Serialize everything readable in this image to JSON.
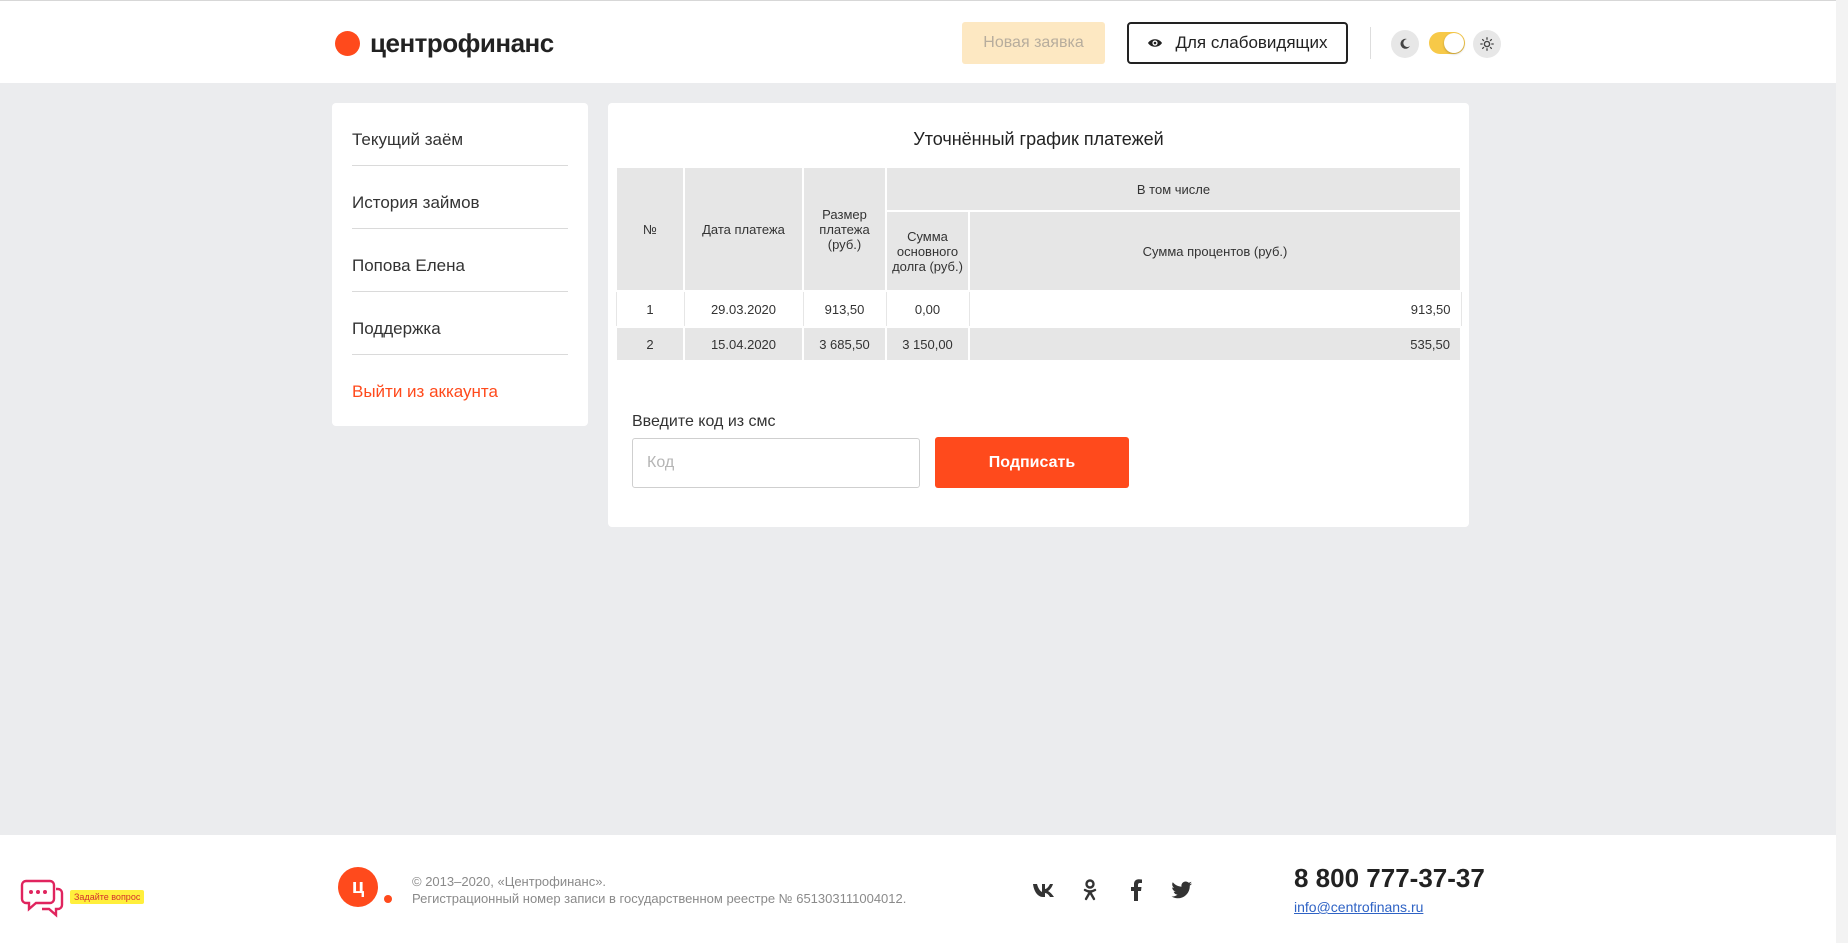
{
  "header": {
    "logo_text": "центрофинанс",
    "new_application": "Новая заявка",
    "visually_impaired": "Для слабовидящих",
    "theme_toggle_state": "light"
  },
  "sidebar": {
    "items": [
      {
        "label": "Текущий заём"
      },
      {
        "label": "История займов"
      },
      {
        "label": "Попова Елена"
      },
      {
        "label": "Поддержка"
      },
      {
        "label": "Выйти из аккаунта"
      }
    ]
  },
  "main": {
    "title": "Уточнённый график платежей",
    "table": {
      "headers": {
        "no": "№",
        "date": "Дата платежа",
        "amount": "Размер платежа (руб.)",
        "including": "В том числе",
        "principal": "Сумма основного долга (руб.)",
        "interest": "Сумма процентов (руб.)"
      },
      "rows": [
        {
          "no": "1",
          "date": "29.03.2020",
          "amount": "913,50",
          "principal": "0,00",
          "interest": "913,50"
        },
        {
          "no": "2",
          "date": "15.04.2020",
          "amount": "3 685,50",
          "principal": "3 150,00",
          "interest": "535,50"
        }
      ]
    },
    "sms_label": "Введите код из смс",
    "sms_placeholder": "Код",
    "sign_button": "Подписать"
  },
  "footer": {
    "chat_badge": "Задайте вопрос",
    "logo_letter": "ц",
    "copyright": "© 2013–2020, «Центрофинанс».",
    "registry": "Регистрационный номер записи в государственном реестре № 651303111004012.",
    "socials": [
      {
        "name": "vk-icon",
        "glyph": "vk"
      },
      {
        "name": "odnoklassniki-icon",
        "glyph": "ok"
      },
      {
        "name": "facebook-icon",
        "glyph": "f"
      },
      {
        "name": "twitter-icon",
        "glyph": "tw"
      }
    ],
    "phone": "8 800 777-37-37",
    "email": "info@centrofinans.ru"
  },
  "colors": {
    "accent": "#ff4a1c",
    "new_app_bg": "#fde8c2",
    "toggle": "#f7c948",
    "page_bg": "#ebecee"
  }
}
